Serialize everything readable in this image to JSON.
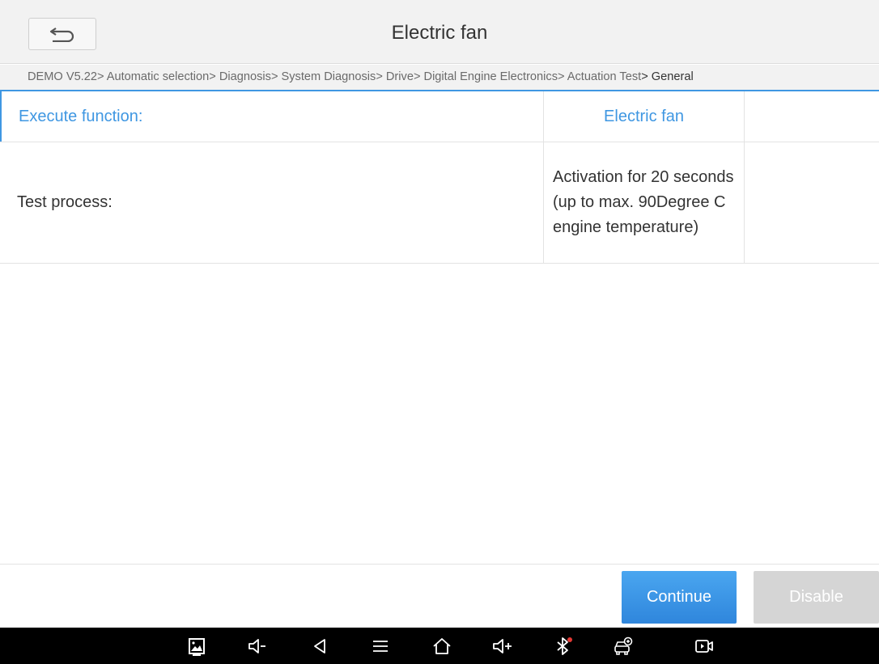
{
  "header": {
    "title": "Electric fan",
    "back_icon": "back-arrow-icon"
  },
  "breadcrumb": {
    "path": "DEMO V5.22> Automatic selection> Diagnosis> System Diagnosis> Drive> Digital Engine Electronics> Actuation Test",
    "current": "> General"
  },
  "table": {
    "header": {
      "label": "Execute function:",
      "value": "Electric fan",
      "extra": ""
    },
    "rows": [
      {
        "label": "Test process:",
        "value": "Activation for 20 seconds (up to max. 90Degree C engine temperature)",
        "extra": ""
      }
    ]
  },
  "actions": {
    "continue_label": "Continue",
    "disable_label": "Disable"
  },
  "system_nav": {
    "icons": [
      "screenshot-icon",
      "volume-down-icon",
      "back-triangle-icon",
      "menu-icon",
      "home-icon",
      "volume-up-icon",
      "bluetooth-icon",
      "vci-car-icon",
      "screen-record-icon"
    ]
  },
  "colors": {
    "accent": "#3f97e2",
    "continue_button": "#3a95e6",
    "disabled_button": "#d5d5d5",
    "nav_background": "#000000",
    "bluetooth_alert": "#e53935"
  }
}
